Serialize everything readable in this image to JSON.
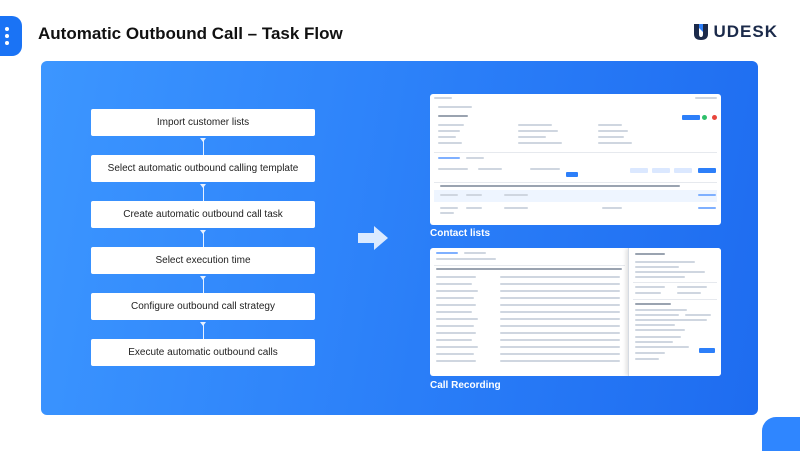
{
  "header": {
    "title": "Automatic Outbound Call – Task Flow",
    "logo_text": "UDESK"
  },
  "flow": {
    "steps": [
      "Import customer lists",
      "Select automatic outbound calling template",
      "Create automatic outbound call task",
      "Select execution time",
      "Configure outbound call strategy",
      "Execute automatic outbound calls"
    ]
  },
  "screenshots": {
    "contact_lists_caption": "Contact lists",
    "call_recording_caption": "Call Recording"
  },
  "colors": {
    "panel": "#2a7ef8",
    "accent": "#1a73f5",
    "logo": "#1b2a4a"
  },
  "icons": {
    "menu": "vertical-dots-icon",
    "arrow": "right-arrow-icon",
    "logo": "udesk-shield-icon"
  }
}
